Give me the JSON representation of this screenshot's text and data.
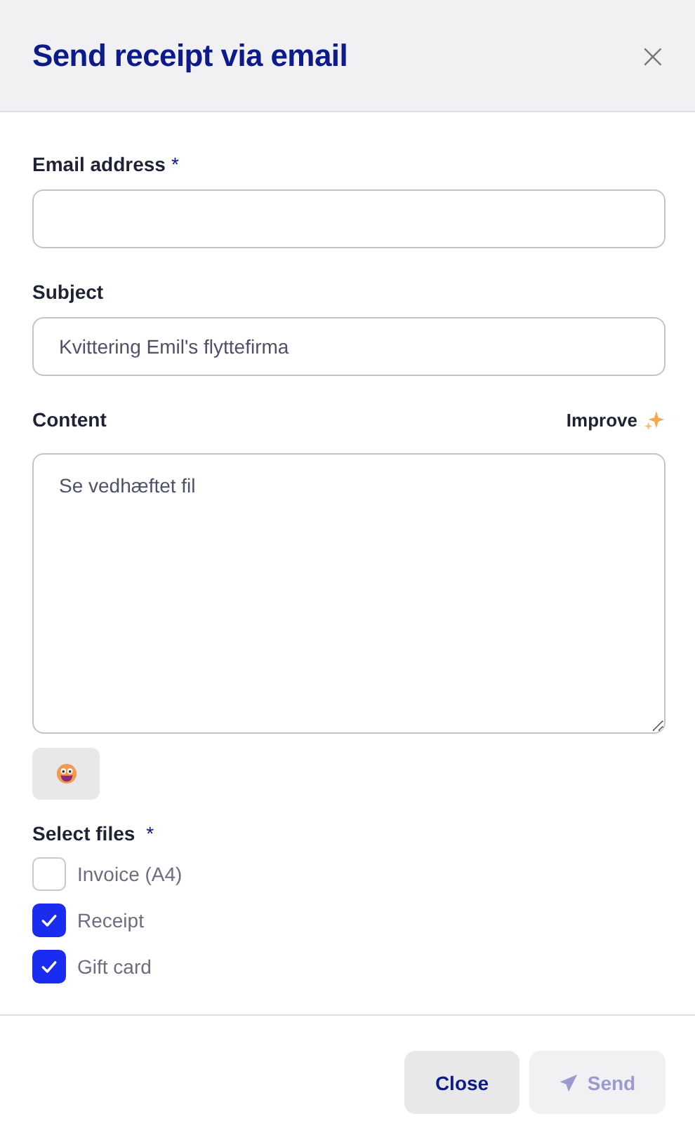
{
  "dialog": {
    "title": "Send receipt via email",
    "close_icon": "×"
  },
  "fields": [
    {
      "kind": "input",
      "label": "Email address",
      "required_mark": "*"
    },
    {
      "kind": "input",
      "label": "Subject",
      "value": "Kvittering Emil's flyttefirma"
    },
    {
      "kind": "textarea",
      "label": "Content",
      "action": "Improve",
      "value": "Se vedhæftet fil"
    }
  ],
  "files": {
    "label": "Select files",
    "required_mark": "*",
    "items": [
      {
        "label": "Invoice (A4)",
        "checked": false
      },
      {
        "label": "Receipt",
        "checked": true
      },
      {
        "label": "Gift card",
        "checked": true
      }
    ]
  },
  "buttons": [
    {
      "kind": "secondary",
      "label": "Close"
    },
    {
      "kind": "send",
      "label": "Send",
      "disabled": true
    }
  ]
}
